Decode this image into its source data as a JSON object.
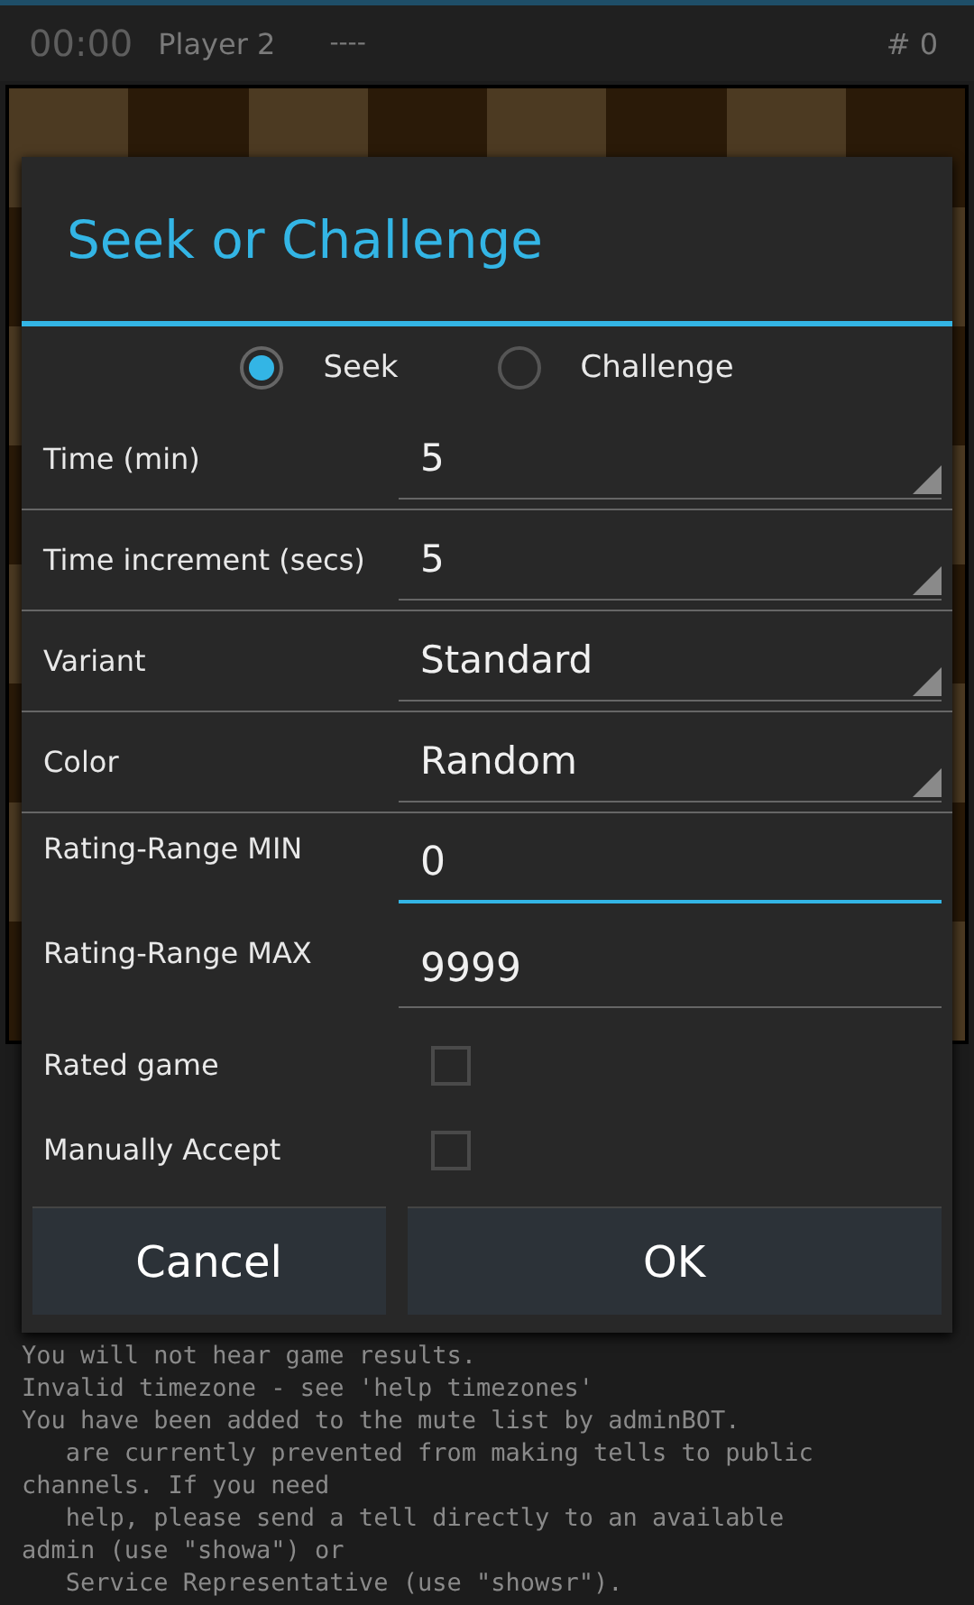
{
  "top_bar": {
    "clock": "00:00",
    "player": "Player 2",
    "moves": "----",
    "move_number": "# 0"
  },
  "console_lines": [
    "You will not hear game results.",
    "Invalid timezone - see 'help timezones'",
    "You have been added to the mute list by adminBOT.",
    "   are currently prevented from making tells to public",
    "channels. If you need",
    "   help, please send a tell directly to an available",
    "admin (use \"showa\") or",
    "   Service Representative (use \"showsr\")."
  ],
  "dialog": {
    "title": "Seek or Challenge",
    "mode": [
      {
        "label": "Seek",
        "selected": true
      },
      {
        "label": "Challenge",
        "selected": false
      }
    ],
    "rows": [
      {
        "kind": "spinner",
        "label": "Time (min)",
        "value": "5"
      },
      {
        "kind": "spinner",
        "label": "Time increment (secs)",
        "value": "5"
      },
      {
        "kind": "spinner",
        "label": "Variant",
        "value": "Standard"
      },
      {
        "kind": "spinner",
        "label": "Color",
        "value": "Random"
      },
      {
        "kind": "text",
        "label": "Rating-Range MIN",
        "value": "0",
        "focused": true
      },
      {
        "kind": "text",
        "label": "Rating-Range MAX",
        "value": "9999",
        "focused": false
      },
      {
        "kind": "checkbox",
        "label": "Rated game",
        "checked": false
      },
      {
        "kind": "checkbox",
        "label": "Manually Accept",
        "checked": false
      }
    ],
    "buttons": [
      "Cancel",
      "OK"
    ]
  }
}
